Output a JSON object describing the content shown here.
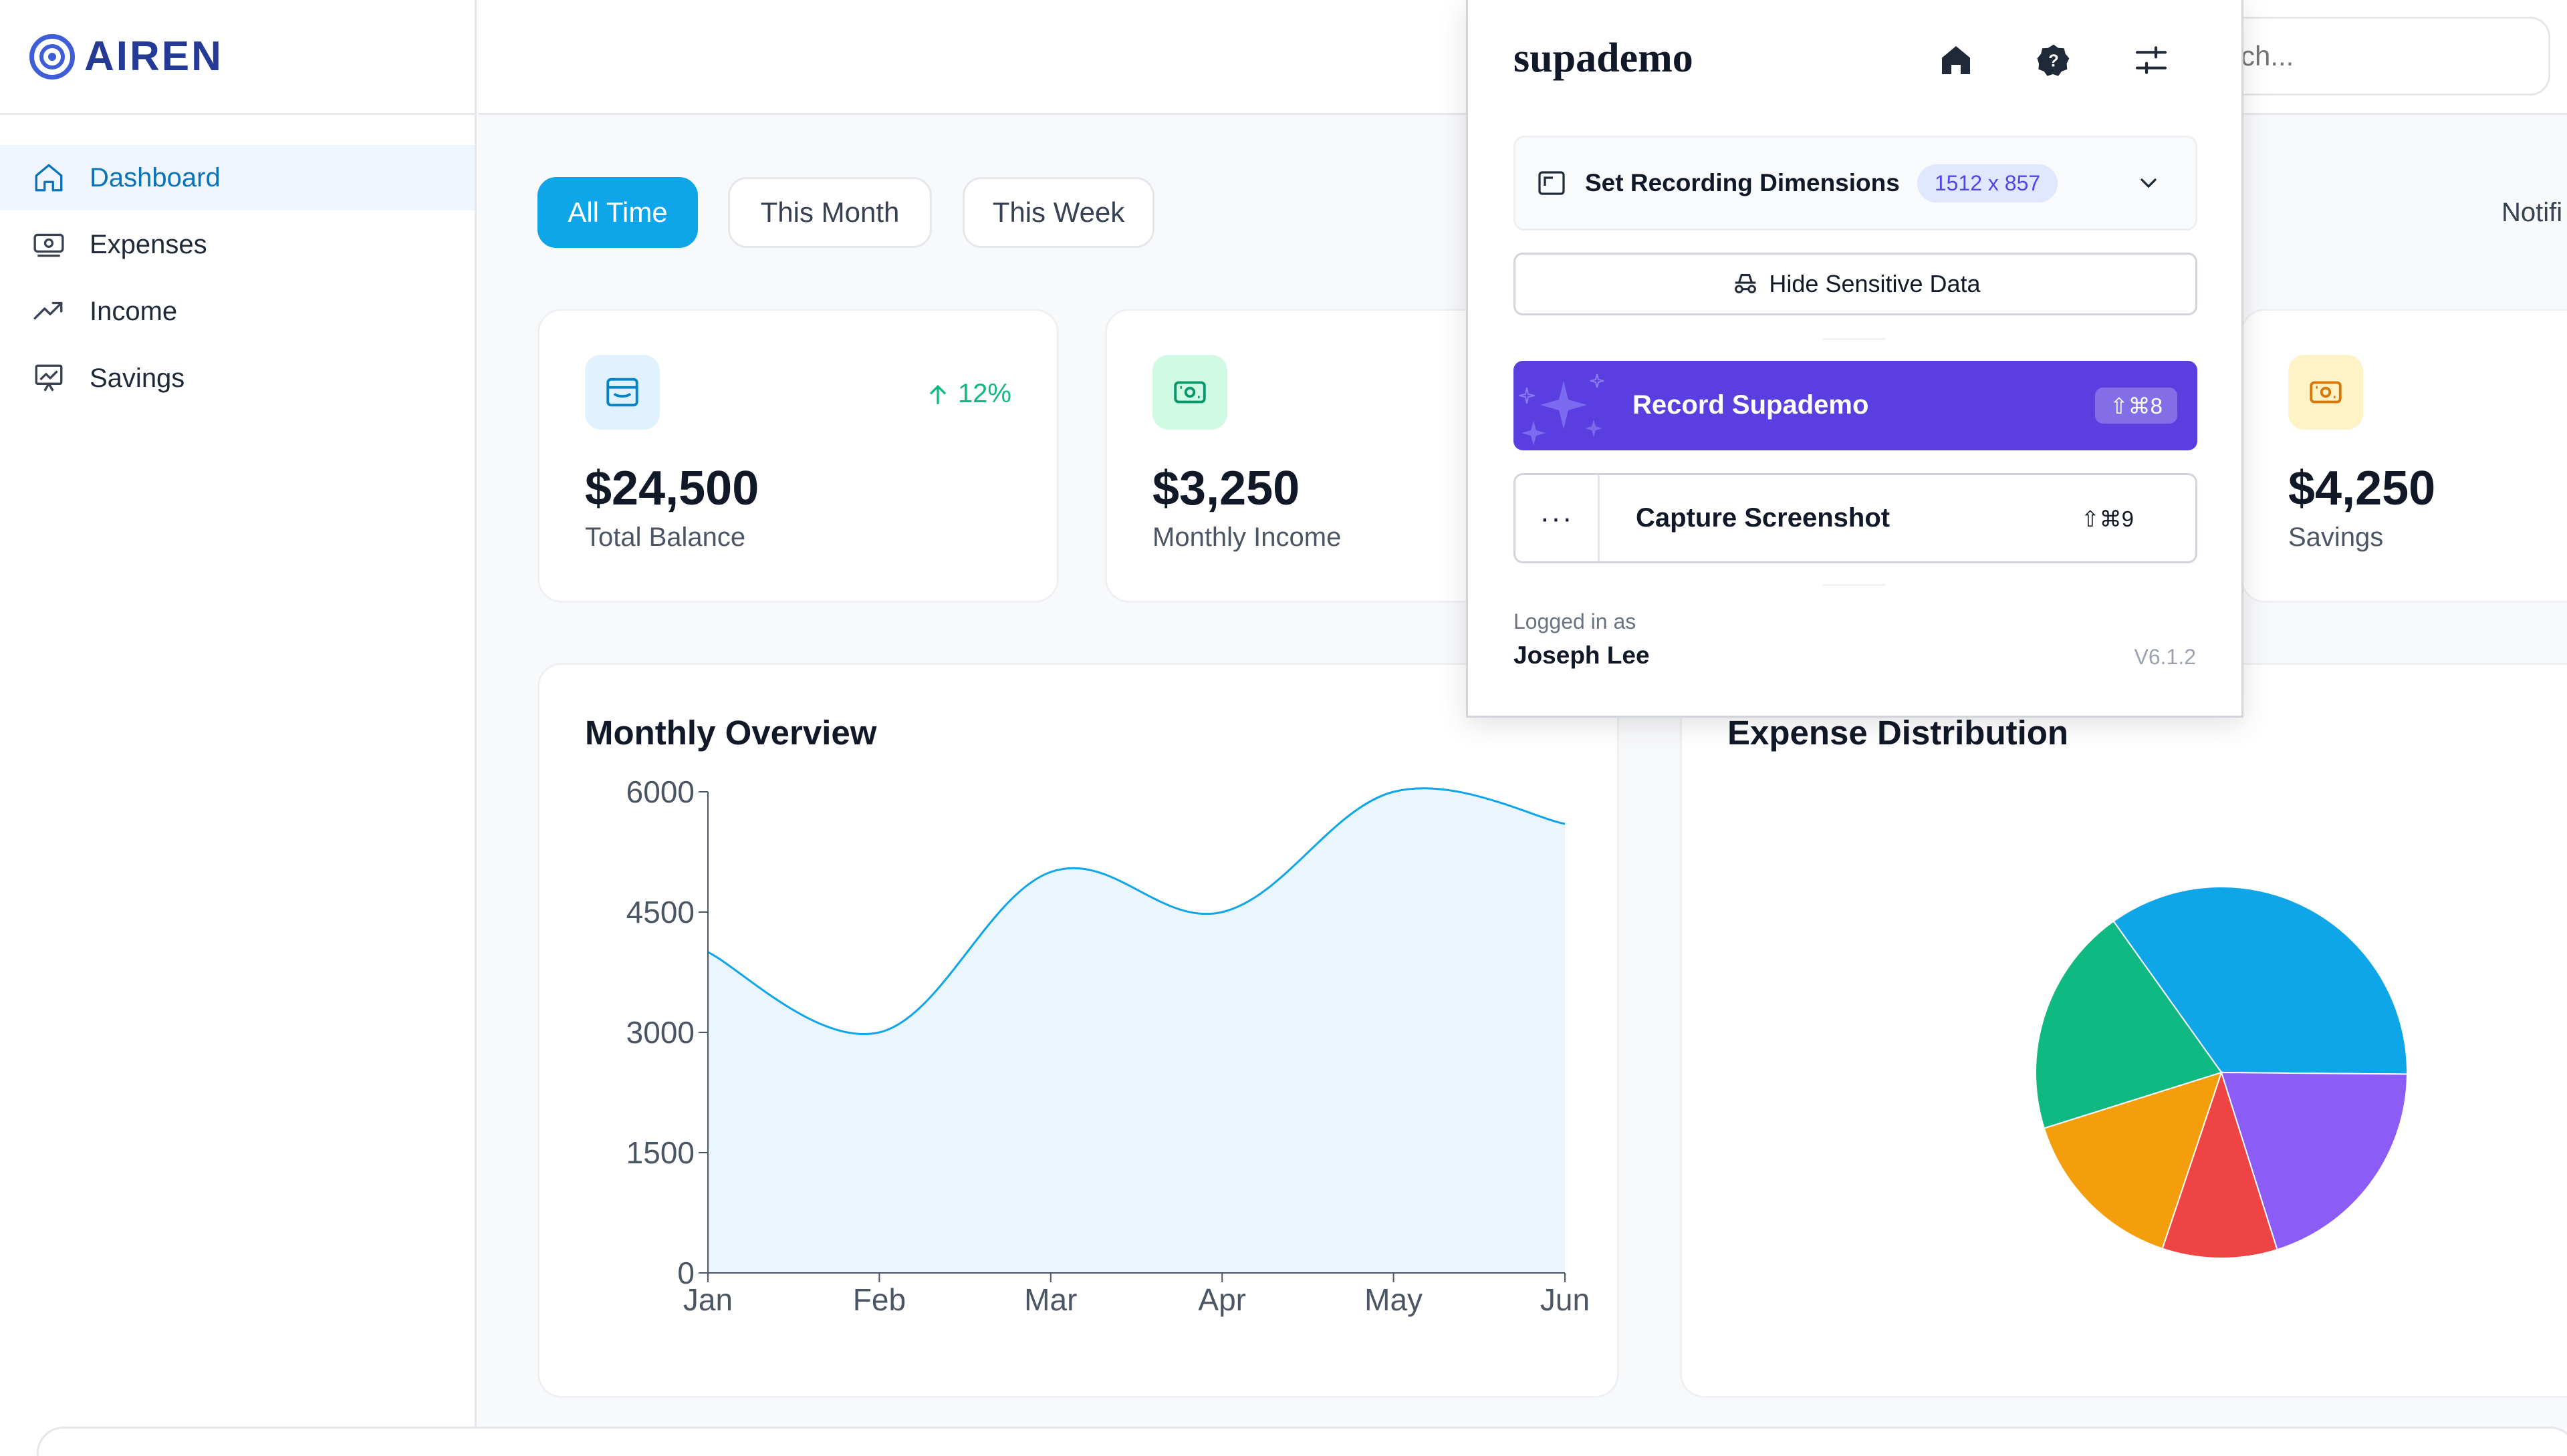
{
  "app": {
    "name": "AIREN"
  },
  "sidebar": {
    "items": [
      {
        "label": "Dashboard",
        "icon": "home-icon",
        "active": true
      },
      {
        "label": "Expenses",
        "icon": "money-icon",
        "active": false
      },
      {
        "label": "Income",
        "icon": "trend-up-icon",
        "active": false
      },
      {
        "label": "Savings",
        "icon": "chart-board-icon",
        "active": false
      }
    ]
  },
  "header": {
    "search_placeholder": "Search...",
    "search_visible": "rch..."
  },
  "filters": {
    "all_time": "All Time",
    "this_month": "This Month",
    "this_week": "This Week",
    "active": "All Time"
  },
  "notifications_label": "Notifi",
  "stats": {
    "total_balance": {
      "value": "$24,500",
      "label": "Total Balance",
      "trend": "12%",
      "color": "#0ea5e9"
    },
    "monthly_income": {
      "value": "$3,250",
      "label": "Monthly Income",
      "color": "#10b981"
    },
    "savings": {
      "value": "$4,250",
      "label": "Savings",
      "color": "#f59e0b"
    }
  },
  "monthly_overview": {
    "title": "Monthly Overview"
  },
  "expense_distribution": {
    "title": "Expense Distribution"
  },
  "chart_data": [
    {
      "type": "area",
      "title": "Monthly Overview",
      "categories": [
        "Jan",
        "Feb",
        "Mar",
        "Apr",
        "May",
        "Jun"
      ],
      "values": [
        4000,
        3000,
        5000,
        4500,
        6000,
        5600
      ],
      "yticks": [
        0,
        1500,
        3000,
        4500,
        6000
      ],
      "ylim": [
        0,
        6000
      ],
      "color": "#0ea5e9",
      "fill": "#eaf5fd"
    },
    {
      "type": "pie",
      "title": "Expense Distribution",
      "values": [
        35,
        20,
        10,
        15,
        20
      ],
      "colors": [
        "#0ea5e9",
        "#8b5cf6",
        "#ef4444",
        "#f59e0b",
        "#10b981"
      ]
    }
  ],
  "supademo": {
    "logo": "supademo",
    "set_dimensions_label": "Set Recording Dimensions",
    "dimensions": "1512 x 857",
    "hide_sensitive": "Hide Sensitive Data",
    "record_label": "Record Supademo",
    "record_shortcut": "⇧⌘8",
    "capture_label": "Capture Screenshot",
    "capture_shortcut": "⇧⌘9",
    "more_label": "···",
    "logged_in_as": "Logged in as",
    "user": "Joseph Lee",
    "version": "V6.1.2",
    "accent": "#5b3ee0"
  }
}
